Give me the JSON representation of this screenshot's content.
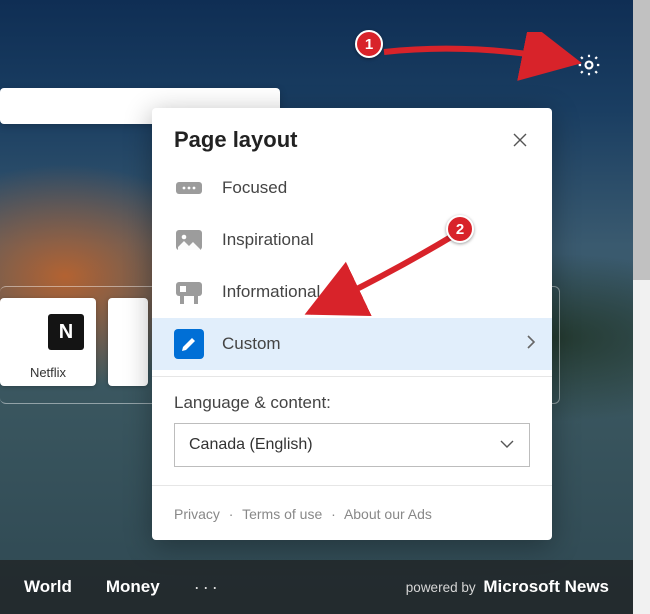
{
  "flyout": {
    "title": "Page layout",
    "options": [
      {
        "label": "Focused",
        "icon": "focused-icon"
      },
      {
        "label": "Inspirational",
        "icon": "inspirational-icon"
      },
      {
        "label": "Informational",
        "icon": "informational-icon"
      },
      {
        "label": "Custom",
        "icon": "custom-icon"
      }
    ],
    "language": {
      "label": "Language & content:",
      "value": "Canada (English)"
    },
    "footer": {
      "privacy": "Privacy",
      "terms": "Terms of use",
      "ads": "About our Ads"
    }
  },
  "tile": {
    "netflix": {
      "label": "Netflix",
      "badge": "N"
    }
  },
  "navbar": {
    "items": [
      "World",
      "Money"
    ],
    "powered_prefix": "powered by",
    "powered_brand": "Microsoft News"
  },
  "annotations": {
    "step1": "1",
    "step2": "2"
  }
}
